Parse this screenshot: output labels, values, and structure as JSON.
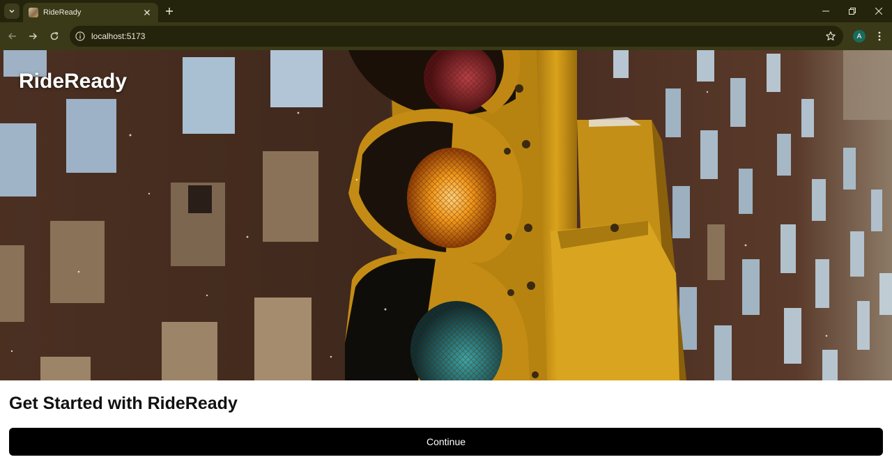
{
  "browser": {
    "tab_title": "RideReady",
    "url": "localhost:5173",
    "profile_initial": "A"
  },
  "page": {
    "brand": "RideReady",
    "heading": "Get Started with RideReady",
    "continue_label": "Continue"
  },
  "colors": {
    "button_bg": "#000000",
    "button_text": "#ffffff",
    "brand_text": "#ffffff",
    "chrome_dark": "#24230b",
    "chrome_mid": "#3a3918"
  }
}
